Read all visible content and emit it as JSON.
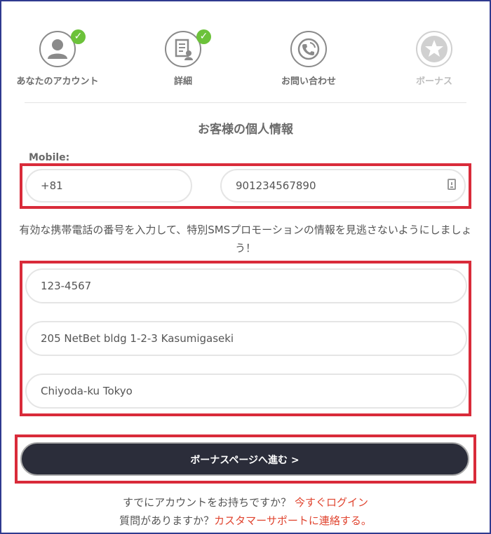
{
  "steps": [
    {
      "label": "あなたのアカウント",
      "icon": "account-icon",
      "done": true
    },
    {
      "label": "詳細",
      "icon": "details-icon",
      "done": true
    },
    {
      "label": "お問い合わせ",
      "icon": "phone-icon",
      "done": false
    },
    {
      "label": "ボーナス",
      "icon": "star-icon",
      "done": false
    }
  ],
  "form": {
    "title": "お客様の個人情報",
    "mobile_label": "Mobile:",
    "country_code": "+81",
    "phone_number": "901234567890",
    "hint": "有効な携帯電話の番号を入力して、特別SMSプロモーションの情報を見逃さないようにしましょう！",
    "postal_code": "123-4567",
    "address_line": "205 NetBet bldg 1-2-3 Kasumigaseki",
    "city": "Chiyoda-ku Tokyo",
    "submit_label": "ボーナスページへ進む >"
  },
  "footer": {
    "account_prompt": "すでにアカウントをお持ちですか？",
    "login_link": "今すぐログイン",
    "question_prompt": "質問がありますか？",
    "support_link": "カスタマーサポートに連絡する。"
  },
  "colors": {
    "highlight": "#d92b3a",
    "check": "#6cc23a",
    "button": "#2b2d3a",
    "link": "#e0442f"
  }
}
